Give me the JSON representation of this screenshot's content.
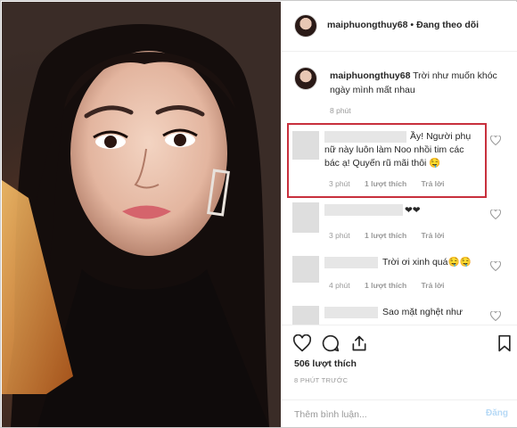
{
  "post": {
    "username": "maiphuongthuy68",
    "separator": "•",
    "follow_status": "Đang theo dõi"
  },
  "caption": {
    "username": "maiphuongthuy68",
    "text": "Trời như muốn khóc ngày mình mất nhau",
    "time": "8 phút"
  },
  "comments": [
    {
      "text": "Ầy! Người phụ nữ này luôn làm Noo nhồi tim các bác ạ! Quyến rũ mãi thôi 🤤",
      "time": "3 phút",
      "likes": "1 lượt thích",
      "reply": "Trả lời"
    },
    {
      "text": "❤❤",
      "time": "3 phút",
      "likes": "1 lượt thích",
      "reply": "Trả lời"
    },
    {
      "text": "Trời ơi xinh quá🤤🤤",
      "time": "4 phút",
      "likes": "1 lượt thích",
      "reply": "Trả lời"
    },
    {
      "text": "Sao mặt nghệt như",
      "time": "",
      "likes": "",
      "reply": ""
    }
  ],
  "actions": {
    "icons": [
      "heart-icon",
      "comment-icon",
      "share-icon",
      "bookmark-icon"
    ],
    "likes_count": "506 lượt thích",
    "posted_ago": "8 PHÚT TRƯỚC"
  },
  "add_comment": {
    "placeholder": "Thêm bình luận...",
    "post_label": "Đăng"
  },
  "colors": {
    "highlight_border": "#c8303d",
    "post_button_disabled": "#b6d9f6",
    "muted_text": "#999999"
  }
}
